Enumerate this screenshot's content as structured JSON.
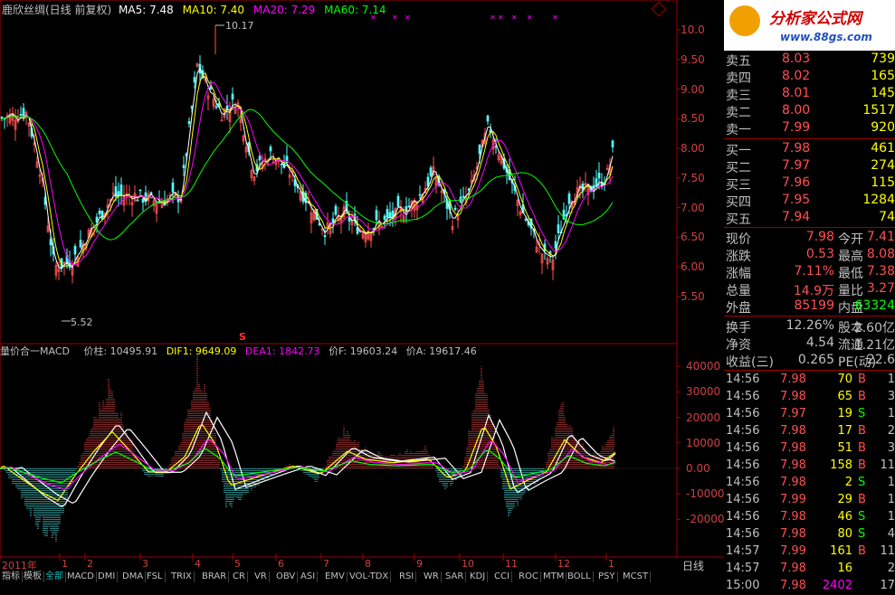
{
  "price_panel": {
    "title": "鹿欣丝绸(日线 前复权)",
    "ma5": "MA5: 7.48",
    "ma10": "MA10: 7.40",
    "ma20": "MA20: 7.29",
    "ma60": "MA60: 7.14",
    "high_label": "10.17",
    "low_label": "5.52",
    "y_ticks": [
      "10.0",
      "9.50",
      "9.00",
      "8.50",
      "8.00",
      "7.50",
      "7.00",
      "6.50",
      "6.00",
      "5.50"
    ],
    "signal_mark": "S"
  },
  "indicator_panel": {
    "title": "量价合一MACD",
    "jiazhu": "价柱: 10495.91",
    "dif": "DIF1: 9649.09",
    "dea": "DEA1: 1842.73",
    "jiaf": "价F: 19603.24",
    "jiaa": "价A: 19617.46",
    "y_ticks": [
      "40000",
      "30000",
      "20000",
      "10000",
      "0.00",
      "-10000",
      "-20000"
    ]
  },
  "x_axis": [
    "2011年",
    "1",
    "2",
    "3",
    "4",
    "5",
    "6",
    "7",
    "8",
    "9",
    "10",
    "11",
    "12",
    "1"
  ],
  "period_label": "日线",
  "tabs": [
    "指标",
    "模板",
    "全部",
    "MACD",
    "DMI",
    "DMA",
    "FSL",
    "TRIX",
    "BRAR",
    "CR",
    "VR",
    "OBV",
    "ASI",
    "EMV",
    "VOL-TDX",
    "RSI",
    "WR",
    "SAR",
    "KDJ",
    "CCI",
    "ROC",
    "MTM",
    "BOLL",
    "PSY",
    "MCST"
  ],
  "active_tab": "全部",
  "logo": {
    "text": "分析家公式网",
    "url": "www.88gs.com"
  },
  "order_book": {
    "sells": [
      {
        "label": "卖五",
        "price": "8.03",
        "vol": "739"
      },
      {
        "label": "卖四",
        "price": "8.02",
        "vol": "165"
      },
      {
        "label": "卖三",
        "price": "8.01",
        "vol": "145"
      },
      {
        "label": "卖二",
        "price": "8.00",
        "vol": "1517"
      },
      {
        "label": "卖一",
        "price": "7.99",
        "vol": "920"
      }
    ],
    "buys": [
      {
        "label": "买一",
        "price": "7.98",
        "vol": "461"
      },
      {
        "label": "买二",
        "price": "7.97",
        "vol": "274"
      },
      {
        "label": "买三",
        "price": "7.96",
        "vol": "115"
      },
      {
        "label": "买四",
        "price": "7.95",
        "vol": "1284"
      },
      {
        "label": "买五",
        "price": "7.94",
        "vol": "74"
      }
    ]
  },
  "quote": [
    {
      "l1": "现价",
      "v1": "7.98",
      "l2": "今开",
      "v2": "7.41"
    },
    {
      "l1": "涨跌",
      "v1": "0.53",
      "l2": "最高",
      "v2": "8.08"
    },
    {
      "l1": "涨幅",
      "v1": "7.11%",
      "l2": "最低",
      "v2": "7.38"
    },
    {
      "l1": "总量",
      "v1": "14.9万",
      "l2": "量比",
      "v2": "3.27"
    },
    {
      "l1": "外盘",
      "v1": "85199",
      "l2": "内盘",
      "v2": "63324"
    }
  ],
  "fundamentals": [
    {
      "l1": "换手",
      "v1": "12.26%",
      "l2": "股本",
      "v2": "2.60亿"
    },
    {
      "l1": "净资",
      "v1": "4.54",
      "l2": "流通",
      "v2": "1.21亿"
    },
    {
      "l1": "收益(三)",
      "v1": "0.265",
      "l2": "PE(动)",
      "v2": "22.6"
    }
  ],
  "ticks": [
    {
      "t": "14:56",
      "p": "7.98",
      "v": "70",
      "s": "B",
      "n": "1"
    },
    {
      "t": "14:56",
      "p": "7.98",
      "v": "65",
      "s": "B",
      "n": "3"
    },
    {
      "t": "14:56",
      "p": "7.97",
      "v": "19",
      "s": "S",
      "n": "1"
    },
    {
      "t": "14:56",
      "p": "7.98",
      "v": "17",
      "s": "B",
      "n": "2"
    },
    {
      "t": "14:56",
      "p": "7.98",
      "v": "51",
      "s": "B",
      "n": "3"
    },
    {
      "t": "14:56",
      "p": "7.98",
      "v": "158",
      "s": "B",
      "n": "11"
    },
    {
      "t": "14:56",
      "p": "7.98",
      "v": "2",
      "s": "S",
      "n": "1"
    },
    {
      "t": "14:56",
      "p": "7.99",
      "v": "29",
      "s": "B",
      "n": "1"
    },
    {
      "t": "14:56",
      "p": "7.98",
      "v": "46",
      "s": "S",
      "n": "1"
    },
    {
      "t": "14:56",
      "p": "7.98",
      "v": "80",
      "s": "S",
      "n": "4"
    },
    {
      "t": "14:57",
      "p": "7.99",
      "v": "161",
      "s": "B",
      "n": "11"
    },
    {
      "t": "14:57",
      "p": "7.98",
      "v": "16",
      "s": "",
      "n": "2"
    },
    {
      "t": "15:00",
      "p": "7.98",
      "v": "2402",
      "s": "",
      "n": "17"
    }
  ],
  "colors": {
    "up": "#ff5050",
    "down": "#54ffff",
    "ma5": "#ffffff",
    "ma10": "#ffff00",
    "ma20": "#ff00ff",
    "ma60": "#00ff00",
    "grid": "#800000"
  }
}
